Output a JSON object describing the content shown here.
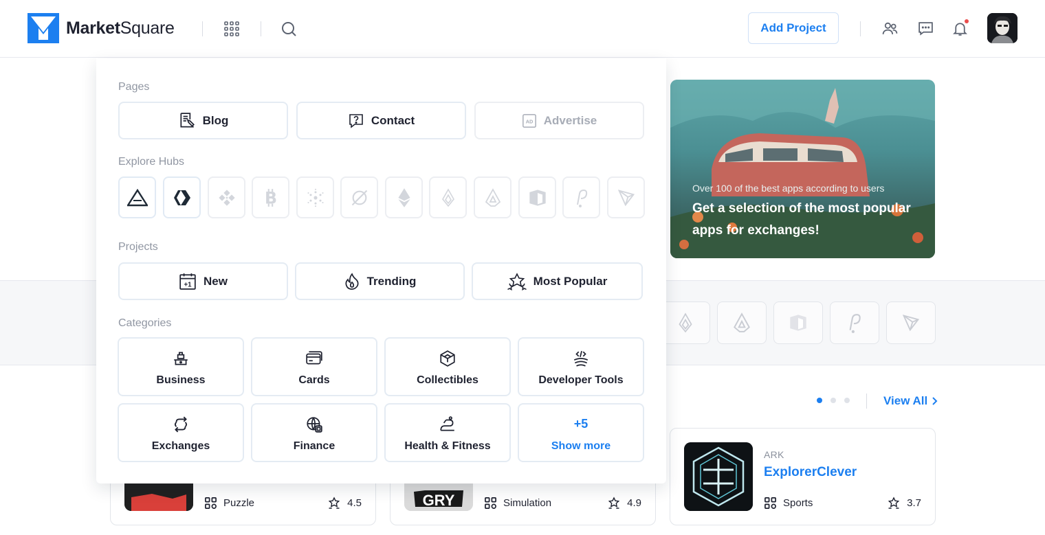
{
  "header": {
    "logo_bold": "Market",
    "logo_light": "Square",
    "add_project_label": "Add Project",
    "icons": [
      "apps-grid-icon",
      "search-icon",
      "users-icon",
      "chat-icon",
      "bell-icon"
    ],
    "accent_color": "#1c7ff0",
    "notification_dot_color": "#ea4d4d"
  },
  "menu": {
    "pages_title": "Pages",
    "pages": [
      {
        "label": "Blog",
        "icon": "blog-icon"
      },
      {
        "label": "Contact",
        "icon": "contact-icon"
      },
      {
        "label": "Advertise",
        "icon": "ad-icon",
        "disabled": true
      }
    ],
    "hubs_title": "Explore Hubs",
    "hubs": [
      {
        "icon": "ark-icon",
        "active": true
      },
      {
        "icon": "hive-icon",
        "active": true
      },
      {
        "icon": "binance-icon",
        "active": false
      },
      {
        "icon": "bitcoin-icon",
        "active": false
      },
      {
        "icon": "cardano-icon",
        "active": false
      },
      {
        "icon": "zero-icon",
        "active": false
      },
      {
        "icon": "ethereum-icon",
        "active": false
      },
      {
        "icon": "flame-chain-icon",
        "active": false
      },
      {
        "icon": "lisk-icon",
        "active": false
      },
      {
        "icon": "cube-chain-icon",
        "active": false
      },
      {
        "icon": "polkadot-icon",
        "active": false
      },
      {
        "icon": "tron-icon",
        "active": false
      }
    ],
    "projects_title": "Projects",
    "projects": [
      {
        "label": "New",
        "icon": "calendar-plus-icon"
      },
      {
        "label": "Trending",
        "icon": "fire-icon"
      },
      {
        "label": "Most Popular",
        "icon": "stars-icon"
      }
    ],
    "categories_title": "Categories",
    "categories": [
      {
        "label": "Business",
        "icon": "business-icon"
      },
      {
        "label": "Cards",
        "icon": "cards-icon"
      },
      {
        "label": "Collectibles",
        "icon": "collectibles-icon"
      },
      {
        "label": "Developer Tools",
        "icon": "developer-tools-icon"
      },
      {
        "label": "Exchanges",
        "icon": "exchanges-icon"
      },
      {
        "label": "Finance",
        "icon": "finance-icon"
      },
      {
        "label": "Health & Fitness",
        "icon": "health-icon"
      }
    ],
    "show_more_count": "+5",
    "show_more_label": "Show more"
  },
  "promo": {
    "subtitle": "Over 100 of the best apps according to users",
    "title": "Get a selection of the most popular apps for exchanges!"
  },
  "listing": {
    "view_all_label": "View All",
    "pagination_active": 1,
    "pagination_total": 3
  },
  "cards": [
    {
      "category": "Puzzle",
      "rating": "4.5"
    },
    {
      "category": "Simulation",
      "rating": "4.9"
    },
    {
      "chain": "ARK",
      "name": "ExplorerClever",
      "category": "Sports",
      "rating": "3.7"
    }
  ]
}
